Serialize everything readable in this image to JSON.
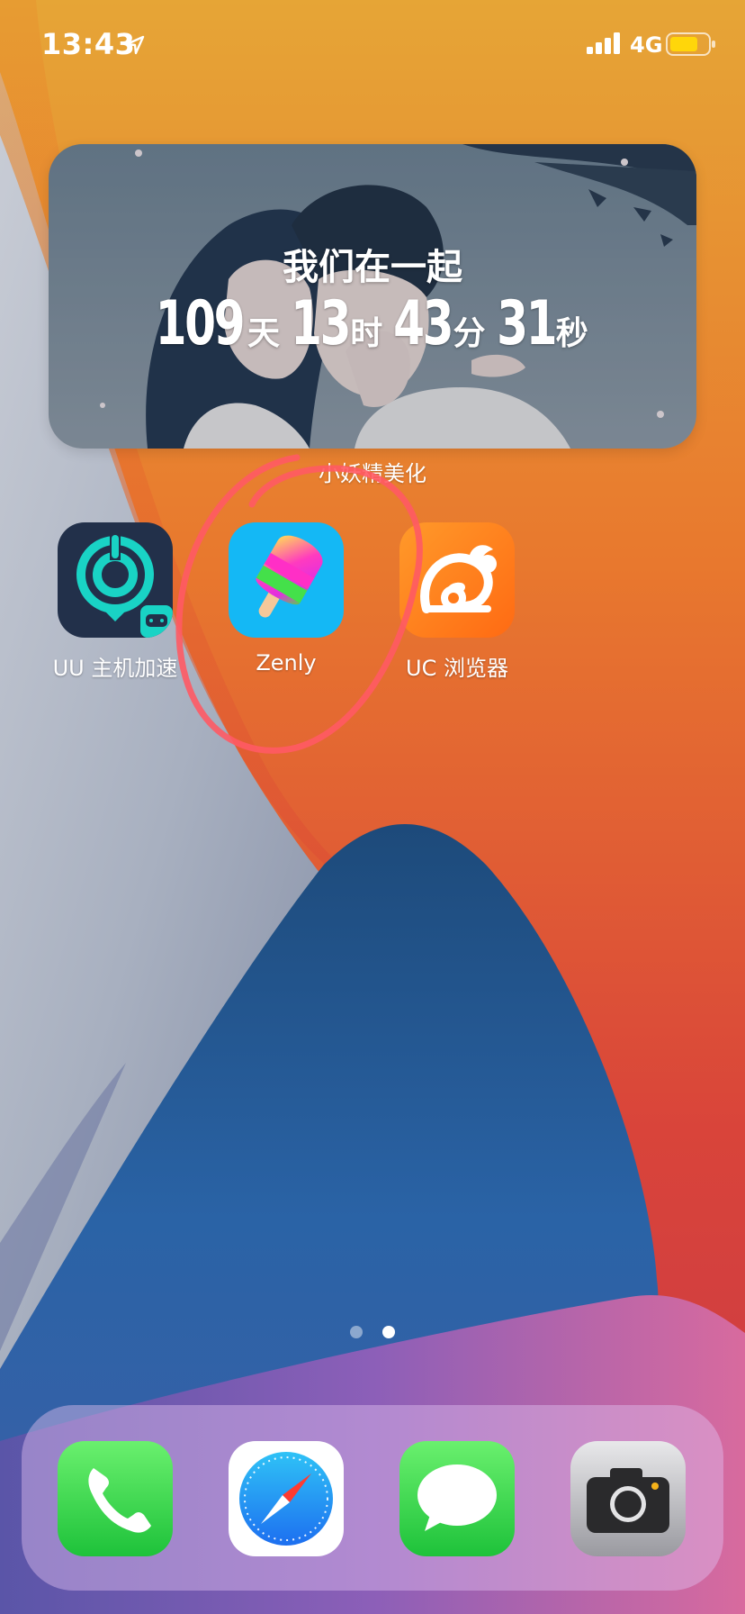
{
  "status_bar": {
    "time": "13:43",
    "network": "4G",
    "location_icon": "location-arrow-icon",
    "signal_icon": "cellular-signal-icon",
    "battery_icon": "battery-icon",
    "battery_color": "#ffd60a"
  },
  "widget": {
    "title": "我们在一起",
    "counter": {
      "days": "109",
      "days_unit": "天",
      "hours": "13",
      "hours_unit": "时",
      "minutes": "43",
      "minutes_unit": "分",
      "seconds": "31",
      "seconds_unit": "秒"
    },
    "app_label": "小妖精美化"
  },
  "apps": [
    {
      "label": "UU 主机加速",
      "icon": "uu-accelerator-icon"
    },
    {
      "label": "Zenly",
      "icon": "zenly-popsicle-icon"
    },
    {
      "label": "UC 浏览器",
      "icon": "uc-squirrel-icon"
    }
  ],
  "page_dots": {
    "count": 2,
    "active_index": 1
  },
  "dock": [
    {
      "name": "Phone",
      "icon": "phone-icon"
    },
    {
      "name": "Safari",
      "icon": "safari-compass-icon"
    },
    {
      "name": "Messages",
      "icon": "message-bubble-icon"
    },
    {
      "name": "Camera",
      "icon": "camera-icon"
    }
  ],
  "colors": {
    "annotation_circle": "#ff5a64",
    "uu_accent": "#19d3c5",
    "zenly_bg": "#14b8f5",
    "uc_orange": "#ff7a1a"
  }
}
